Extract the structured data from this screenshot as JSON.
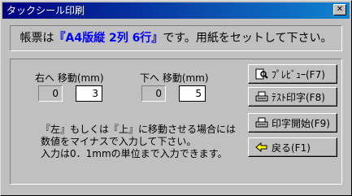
{
  "window": {
    "title": "タックシール印刷",
    "close": "✕"
  },
  "header": {
    "prefix": "帳票は",
    "highlight": "『A4版縦 2列 6行』",
    "suffix": "です。用紙をセットして下さい。"
  },
  "move": {
    "right": {
      "label": "右へ 移動(mm)",
      "current": "0",
      "input": "3"
    },
    "down": {
      "label": "下へ 移動(mm)",
      "current": "0",
      "input": "5"
    }
  },
  "note": [
    "『左』もしくは『上』に移動させる場合には",
    "数値をマイナスで入力して下さい。",
    "入力は0．1mmの単位まで入力できます。"
  ],
  "buttons": {
    "preview": "ﾌﾟﾚﾋﾞｭｰ(F7)",
    "test_print": "ﾃｽﾄ印字(F8)",
    "start_print": "印字開始(F9)",
    "back": "戻る(F1)"
  }
}
